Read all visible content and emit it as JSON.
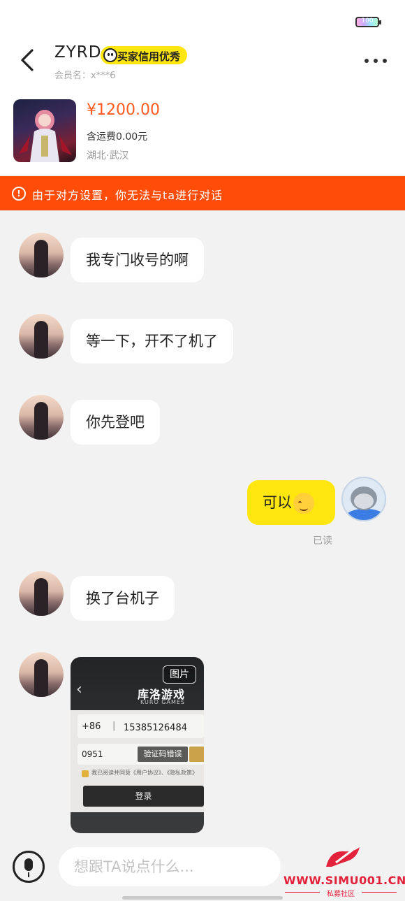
{
  "status_bar": {
    "battery": "100"
  },
  "header": {
    "title": "ZYRD",
    "badge": "买家信用优秀",
    "member": "会员名：x***6"
  },
  "product": {
    "price": "¥1200.00",
    "shipping": "含运费0.00元",
    "location": "湖北·武汉"
  },
  "warning": {
    "icon": "!",
    "text": "由于对方设置，你无法与ta进行对话"
  },
  "messages": [
    {
      "from": "other",
      "text": "我专门收号的啊"
    },
    {
      "from": "other",
      "text": "等一下，开不了机了"
    },
    {
      "from": "other",
      "text": "你先登吧"
    },
    {
      "from": "me",
      "text": "可以",
      "emoji": "smiling-face-icon",
      "status": "已读"
    },
    {
      "from": "other",
      "text": "换了台机子"
    },
    {
      "from": "other",
      "type": "image",
      "tag": "图片"
    }
  ],
  "image_content": {
    "back": "‹",
    "logo": "库洛游戏",
    "logo_sub": "KURO GAMES",
    "country_code": "+86",
    "separator": "|",
    "phone": "15385126484",
    "code": "0951",
    "error": "验证码错误",
    "agree": "我已阅读并同意《用户协议》、《隐私政策》",
    "login": "登录"
  },
  "input": {
    "placeholder": "想跟TA说点什么..."
  },
  "watermark": {
    "url": "WWW.SIMU001.CN",
    "sub": "私募社区"
  },
  "colors": {
    "accent_yellow": "#ffe60f",
    "warning": "#ff4d09",
    "price": "#ff5a1f",
    "watermark": "#e2213b"
  }
}
